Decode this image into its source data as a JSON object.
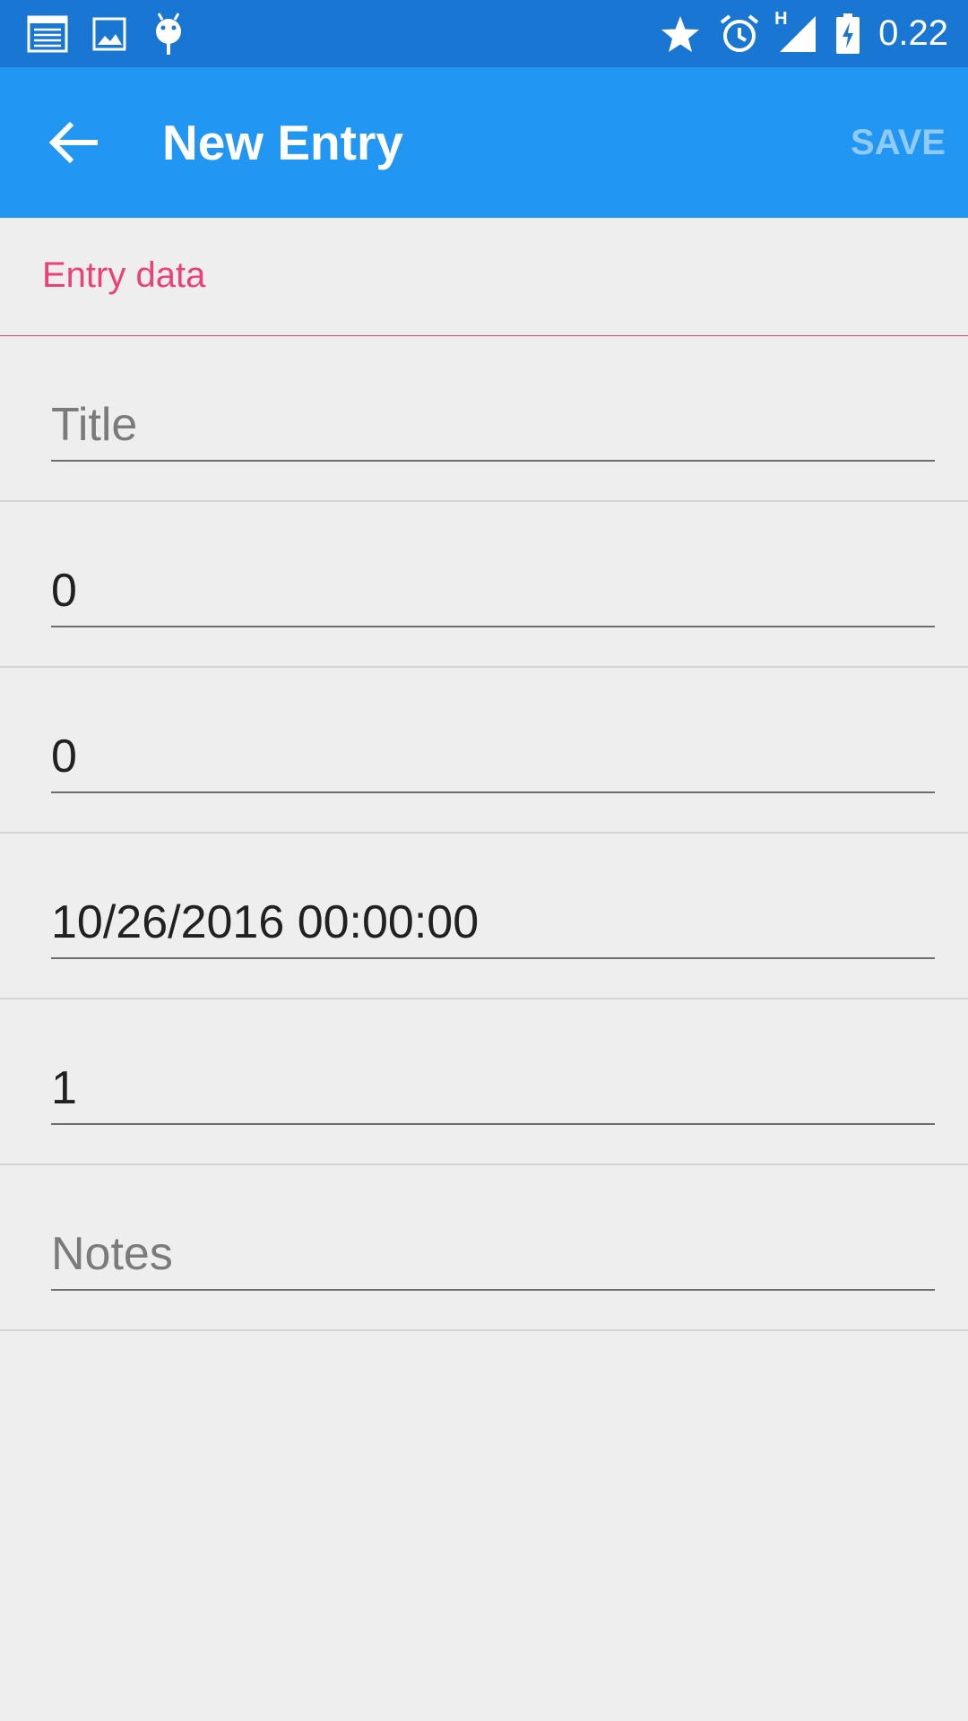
{
  "status_bar": {
    "time": "0.22",
    "network_label": "H",
    "left_icons": [
      "notes-icon",
      "image-icon",
      "android-debug-icon"
    ],
    "right_icons": [
      "star-icon",
      "alarm-icon",
      "signal-icon",
      "battery-charging-icon"
    ]
  },
  "app_bar": {
    "title": "New Entry",
    "save_label": "SAVE",
    "back_icon": "arrow-back-icon",
    "background": "#2196f3",
    "status_background": "#1976d2",
    "save_color": "#90caf9"
  },
  "section": {
    "title": "Entry data",
    "accent": "#ec407a"
  },
  "fields": [
    {
      "value": "",
      "placeholder": "Title"
    },
    {
      "value": "0",
      "placeholder": ""
    },
    {
      "value": "0",
      "placeholder": ""
    },
    {
      "value": "10/26/2016 00:00:00",
      "placeholder": ""
    },
    {
      "value": "1",
      "placeholder": ""
    },
    {
      "value": "",
      "placeholder": "Notes"
    }
  ]
}
